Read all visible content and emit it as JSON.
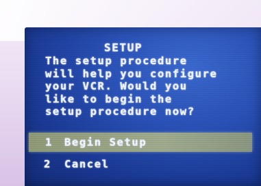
{
  "screen": {
    "title": "SETUP",
    "message": "The setup procedure\nwill help you configure\nyour VCR. Would you\nlike to begin the\nsetup procedure now?"
  },
  "menu": {
    "items": [
      {
        "number": "1",
        "label": "Begin Setup",
        "selected": true
      },
      {
        "number": "2",
        "label": "Cancel",
        "selected": false
      }
    ]
  },
  "colors": {
    "screen_blue": "#2a52b8",
    "text": "#f4f6ff",
    "highlight": "#a2ac86"
  }
}
